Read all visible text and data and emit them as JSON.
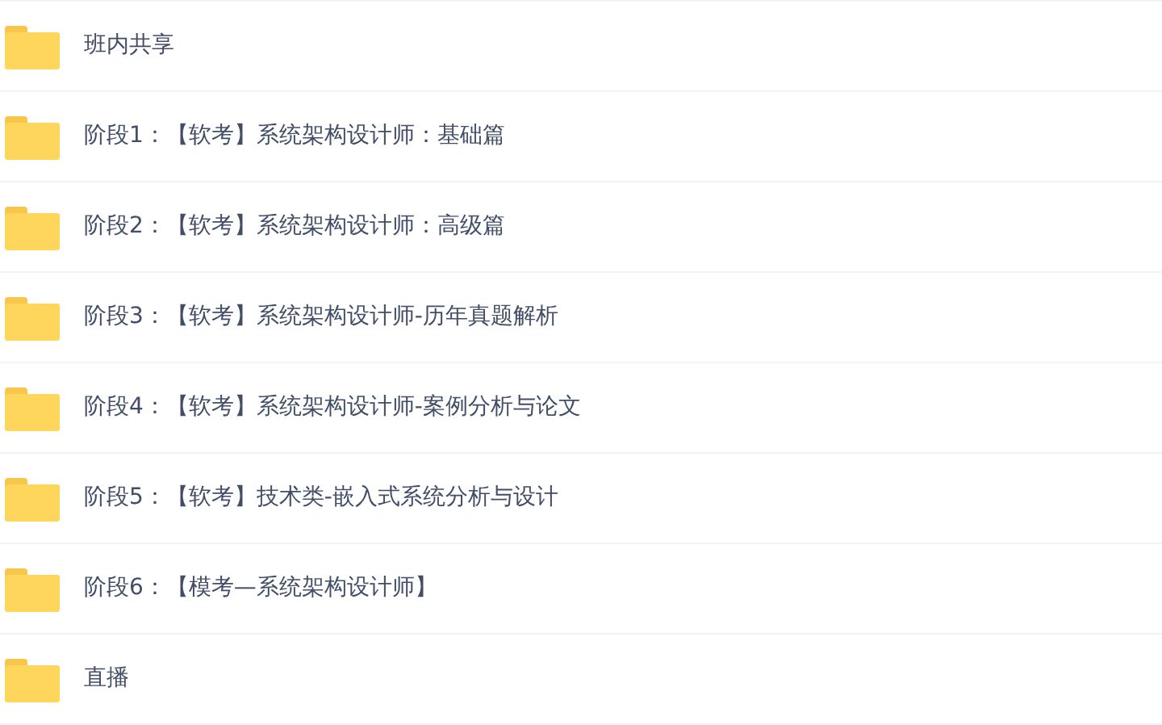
{
  "folders": [
    {
      "name": "班内共享"
    },
    {
      "name": "阶段1：【软考】系统架构设计师：基础篇"
    },
    {
      "name": "阶段2：【软考】系统架构设计师：高级篇"
    },
    {
      "name": "阶段3：【软考】系统架构设计师-历年真题解析"
    },
    {
      "name": "阶段4：【软考】系统架构设计师-案例分析与论文"
    },
    {
      "name": "阶段5：【软考】技术类-嵌入式系统分析与设计"
    },
    {
      "name": "阶段6：【模考—系统架构设计师】"
    },
    {
      "name": "直播"
    }
  ]
}
